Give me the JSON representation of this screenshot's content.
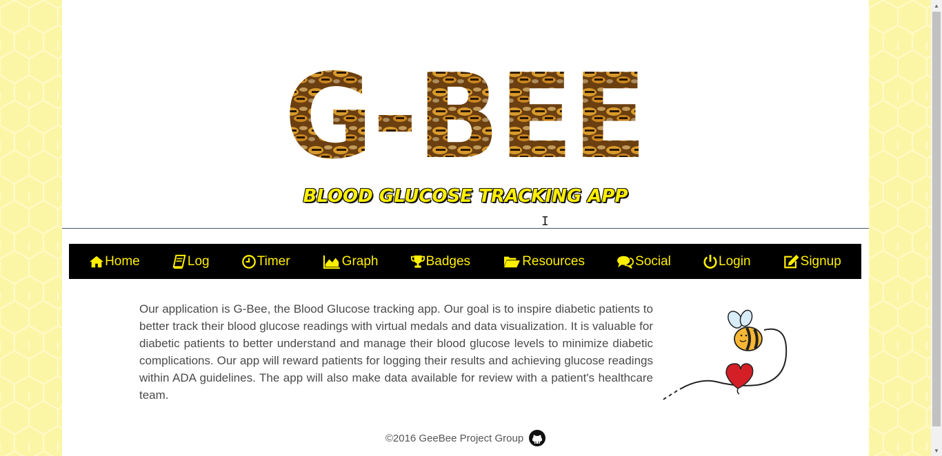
{
  "brand": {
    "logo_text": "G-BEE",
    "tagline": "BLOOD GLUCOSE TRACKING APP"
  },
  "nav": {
    "items": [
      {
        "label": "Home",
        "icon": "home-icon"
      },
      {
        "label": "Log",
        "icon": "book-icon"
      },
      {
        "label": "Timer",
        "icon": "clock-icon"
      },
      {
        "label": "Graph",
        "icon": "area-chart-icon"
      },
      {
        "label": "Badges",
        "icon": "trophy-icon"
      },
      {
        "label": "Resources",
        "icon": "folder-open-icon"
      },
      {
        "label": "Social",
        "icon": "comments-icon"
      },
      {
        "label": "Login",
        "icon": "power-icon"
      },
      {
        "label": "Signup",
        "icon": "edit-icon"
      }
    ]
  },
  "intro": {
    "text": "Our application is G-Bee, the Blood Glucose tracking app. Our goal is to inspire diabetic patients to better track their blood glucose readings with virtual medals and data visualization. It is valuable for diabetic patients to better understand and manage their blood glucose levels to minimize diabetic complications. Our app will reward patients for logging their results and achieving glucose readings within ADA guidelines. The app will also make data available for review with a patient's healthcare team."
  },
  "footer": {
    "copyright": "©2016 GeeBee Project Group",
    "icon": "github-icon"
  },
  "colors": {
    "accent": "#ffef00",
    "navbar_bg": "#000000",
    "page_bg": "#fbf6a6"
  }
}
